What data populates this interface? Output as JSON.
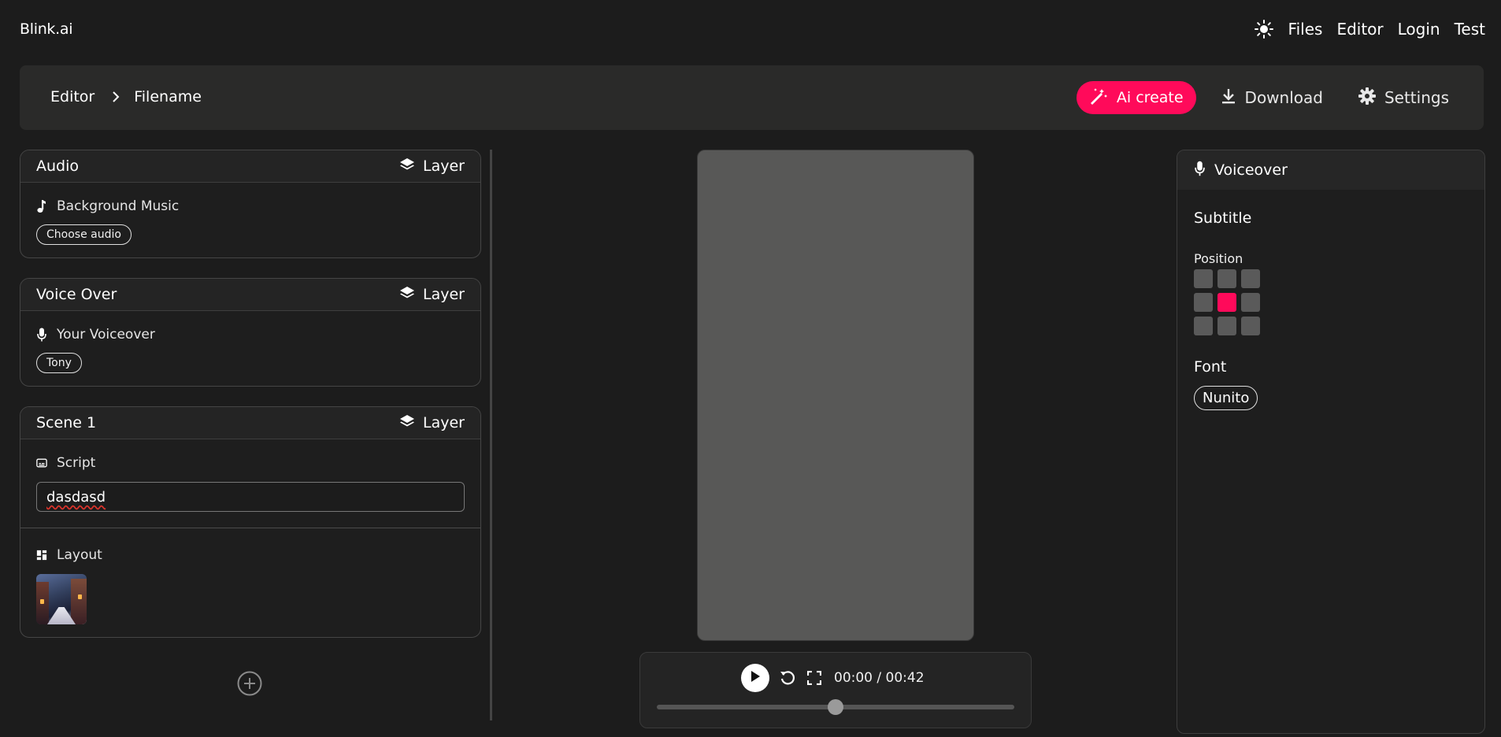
{
  "app": {
    "brand": "Blink.ai"
  },
  "nav": {
    "files": "Files",
    "editor": "Editor",
    "login": "Login",
    "test": "Test"
  },
  "breadcrumb": {
    "root": "Editor",
    "current": "Filename"
  },
  "toolbar": {
    "ai_create": "Ai create",
    "download": "Download",
    "settings": "Settings"
  },
  "colors": {
    "accent": "#ff0a5a",
    "background": "#1c1c1c",
    "panel": "#2a2a29"
  },
  "cards": {
    "audio": {
      "title": "Audio",
      "layer": "Layer",
      "label": "Background Music",
      "button": "Choose audio"
    },
    "voiceover": {
      "title": "Voice Over",
      "layer": "Layer",
      "label": "Your Voiceover",
      "voice": "Tony"
    },
    "scene1": {
      "title": "Scene 1",
      "layer": "Layer",
      "script_label": "Script",
      "script_value": "dasdasd",
      "layout_label": "Layout"
    }
  },
  "player": {
    "time": "00:00 / 00:42",
    "progress": 0.5
  },
  "right_panel": {
    "header": "Voiceover",
    "subtitle": "Subtitle",
    "position_label": "Position",
    "position_selected": "middle-center",
    "font_label": "Font",
    "font_value": "Nunito"
  }
}
